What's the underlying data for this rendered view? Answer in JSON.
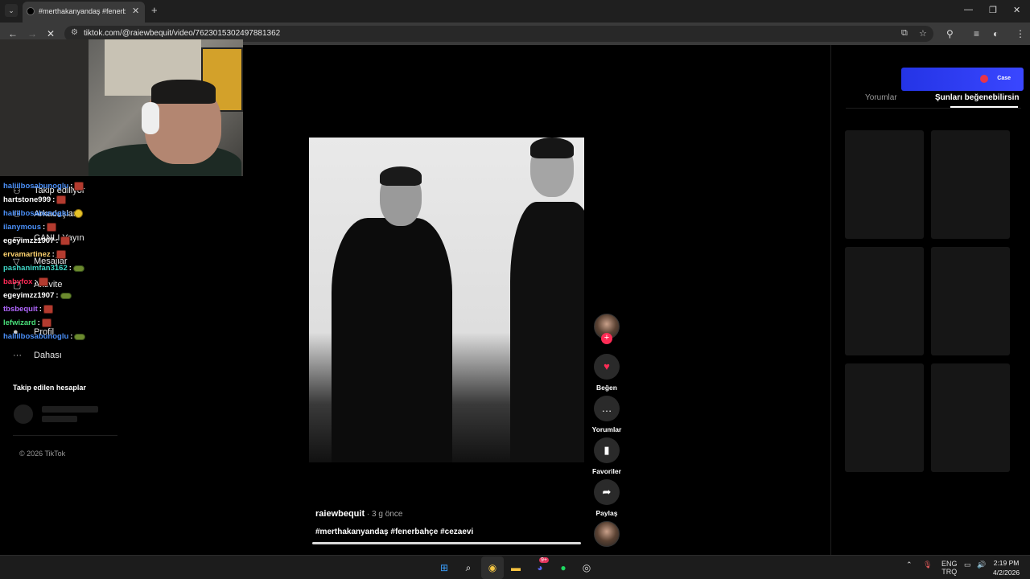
{
  "browser": {
    "tab_title": "#merthakanyandaş #fenerbahçe",
    "url": "tiktok.com/@raiewbequit/video/7623015302497881362",
    "icons": [
      "tab-search-icon",
      "close-icon",
      "new-tab-icon",
      "minimize-icon",
      "restore-icon",
      "window-close-icon",
      "back-icon",
      "forward-icon",
      "stop-loading-icon",
      "site-info-icon",
      "install-app-icon",
      "bookmark-star-icon",
      "extensions-icon",
      "media-controls-icon",
      "profile-icon",
      "more-menu-icon"
    ]
  },
  "sidebar": {
    "items": [
      {
        "label": "Takip ediliyor",
        "icon": "following-icon"
      },
      {
        "label": "Arkadaşlar",
        "icon": "friends-icon"
      },
      {
        "label": "CANLI Yayın",
        "icon": "live-icon"
      },
      {
        "label": "Mesajlar",
        "icon": "messages-icon"
      },
      {
        "label": "Aktivite",
        "icon": "activity-icon"
      },
      {
        "label": "Profil",
        "icon": "profile-icon"
      },
      {
        "label": "Dahası",
        "icon": "more-icon"
      }
    ],
    "following_heading": "Takip edilen hesaplar",
    "copyright": "© 2026 TikTok"
  },
  "chat": {
    "messages": [
      {
        "user": "haliilbosabunoglu",
        "color": "#4a8ff7",
        "emote": "red"
      },
      {
        "user": "hartstone999",
        "color": "#ffffff",
        "emote": "red"
      },
      {
        "user": "haliilbosabunoglu",
        "color": "#4a8ff7",
        "emote": "yellow"
      },
      {
        "user": "ilanymous",
        "color": "#4a8ff7",
        "emote": "red"
      },
      {
        "user": "egeyimzz1907",
        "color": "#ffffff",
        "emote": "red"
      },
      {
        "user": "ervamartinez",
        "color": "#ffd36e",
        "emote": "red"
      },
      {
        "user": "pashanimfan3162",
        "color": "#3fd6c6",
        "emote": "green"
      },
      {
        "user": "babyfox",
        "color": "#ff2a57",
        "emote": "red"
      },
      {
        "user": "egeyimzz1907",
        "color": "#ffffff",
        "emote": "green"
      },
      {
        "user": "tbsbequit",
        "color": "#b167ff",
        "emote": "red"
      },
      {
        "user": "lefwizard",
        "color": "#49e07a",
        "emote": "red"
      },
      {
        "user": "haliilbosabunoglu",
        "color": "#4a8ff7",
        "emote": "green"
      }
    ]
  },
  "video": {
    "author": "raiewbequit",
    "time": " · 3 g önce",
    "hashtags": "#merthakanyandaş #fenerbahçe #cezaevi",
    "follow_symbol": "+"
  },
  "actions": {
    "like": {
      "label": "Beğen",
      "icon": "heart-icon",
      "glyph": "♥",
      "color": "#fe2c55"
    },
    "comments": {
      "label": "Yorumlar",
      "icon": "comment-icon",
      "glyph": "…"
    },
    "favorites": {
      "label": "Favoriler",
      "icon": "bookmark-icon",
      "glyph": "▮"
    },
    "share": {
      "label": "Paylaş",
      "icon": "share-icon",
      "glyph": "➦"
    }
  },
  "right_panel": {
    "tabs": [
      "Yorumlar",
      "Şunları beğenebilirsin"
    ],
    "active_tab": 1,
    "ad_text": "Case"
  },
  "taskbar": {
    "apps": [
      {
        "name": "windows-start-icon",
        "glyph": "⊞",
        "color": "#3aa0ff"
      },
      {
        "name": "search-icon",
        "glyph": "⌕",
        "color": "#ffffff"
      },
      {
        "name": "chrome-icon",
        "glyph": "◉",
        "color": "#f2c443"
      },
      {
        "name": "file-explorer-icon",
        "glyph": "▬",
        "color": "#f6c240"
      },
      {
        "name": "discord-icon",
        "glyph": "◕",
        "color": "#5865f2"
      },
      {
        "name": "spotify-icon",
        "glyph": "●",
        "color": "#1ed760"
      },
      {
        "name": "steam-icon",
        "glyph": "◎",
        "color": "#dddddd"
      }
    ],
    "discord_badge": "9+",
    "lang_top": "ENG",
    "lang_bottom": "TRQ",
    "time": "2:19 PM",
    "date": "4/2/2026"
  }
}
